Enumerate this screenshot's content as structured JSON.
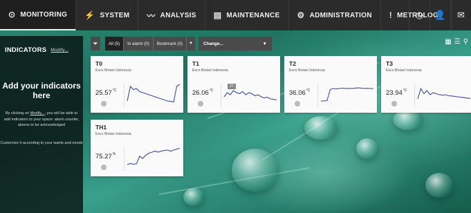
{
  "nav": {
    "items": [
      {
        "label": "MONITORING",
        "icon": "monitoring-icon",
        "glyph": "⊙",
        "active": true
      },
      {
        "label": "SYSTEM",
        "icon": "bolt-icon",
        "glyph": "⚡"
      },
      {
        "label": "ANALYSIS",
        "icon": "analysis-icon",
        "glyph": "〰"
      },
      {
        "label": "MAINTENANCE",
        "icon": "maintenance-icon",
        "glyph": "▤"
      },
      {
        "label": "ADMINISTRATION",
        "icon": "admin-icon",
        "glyph": "⚙"
      },
      {
        "label": "METROLOGY",
        "icon": "metrology-icon",
        "glyph": "!"
      }
    ],
    "right_icons": [
      "clock-icon",
      "user-icon",
      "mail-icon"
    ]
  },
  "left_panel": {
    "header": "INDICATORS",
    "modify_link": "Modify...",
    "title": "Add your indicators here",
    "desc_before": "By clicking on",
    "desc_link": "Modify...",
    "desc_after": ", you will be able to add indicators to your space: alarm counter, alarms to be acknowledged",
    "customize": "Customize it according to your wants and needs"
  },
  "filter": {
    "all": "All (5)",
    "in_alarm": "In alarm (0)",
    "bookmark": "Bookmark (0)",
    "change": "Change..."
  },
  "cards": [
    {
      "name": "T0",
      "site": "Esco Bintan Indonesia",
      "value": "25.57",
      "unit": "°C",
      "trend": [
        0.9,
        0.2,
        0.35,
        0.3,
        0.45,
        0.5,
        0.55,
        0.6,
        0.65,
        0.7,
        0.75,
        0.8,
        0.85,
        0.9,
        0.92,
        0.95,
        0.2,
        0.1
      ]
    },
    {
      "name": "T1",
      "site": "Esco Bintan Indonesia",
      "value": "26.06",
      "unit": "°C",
      "badge": "27",
      "trend": [
        0.7,
        0.5,
        0.6,
        0.4,
        0.5,
        0.55,
        0.45,
        0.6,
        0.5,
        0.55,
        0.65,
        0.6,
        0.7,
        0.75,
        0.72,
        0.8,
        0.82,
        0.85
      ]
    },
    {
      "name": "T2",
      "site": "Esco Bintan Indonesia",
      "value": "36.06",
      "unit": "°C",
      "trend": [
        0.9,
        0.9,
        0.88,
        0.35,
        0.3,
        0.32,
        0.3,
        0.28,
        0.3,
        0.29,
        0.3,
        0.28,
        0.27,
        0.28,
        0.3,
        0.29,
        0.3,
        0.3
      ]
    },
    {
      "name": "T3",
      "site": "Esco Bintan Indonesia",
      "value": "23.94",
      "unit": "°C",
      "trend": [
        0.8,
        0.3,
        0.55,
        0.4,
        0.6,
        0.5,
        0.55,
        0.6,
        0.62,
        0.6,
        0.65,
        0.66,
        0.68,
        0.7,
        0.72,
        0.74,
        0.76,
        0.78
      ]
    },
    {
      "name": "TH1",
      "site": "Esco Bintan Indonesia",
      "value": "75.27",
      "unit": "%",
      "trend": [
        0.9,
        0.85,
        0.88,
        0.86,
        0.5,
        0.6,
        0.45,
        0.35,
        0.3,
        0.25,
        0.3,
        0.25,
        0.22,
        0.2,
        0.25,
        0.2,
        0.15,
        0.12
      ]
    }
  ]
}
